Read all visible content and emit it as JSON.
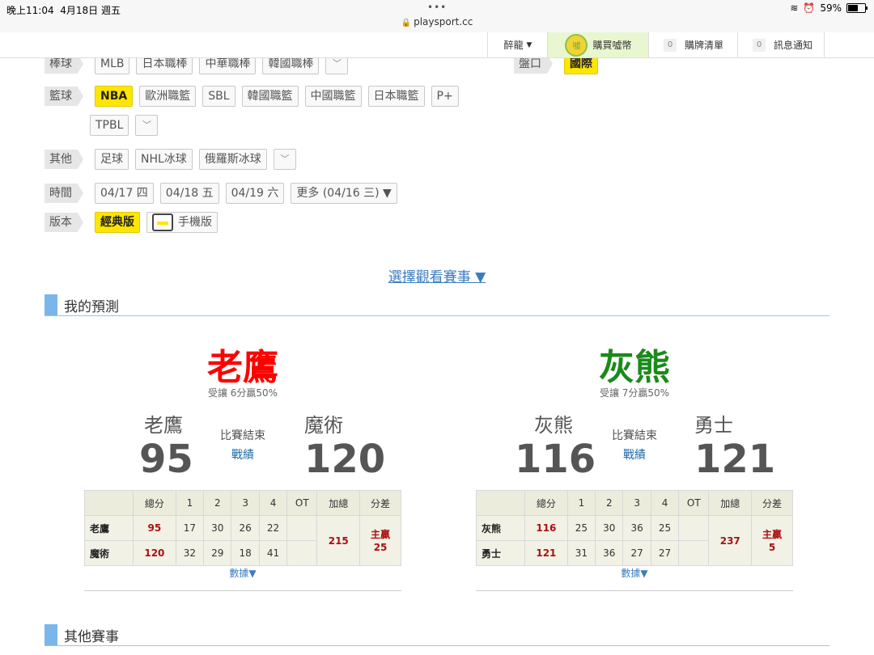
{
  "statusbar": {
    "time": "晚上11:04",
    "date": "4月18日 週五",
    "dots": "•••",
    "url": "playsport.cc",
    "battery": "59%",
    "battery_level": 0.59
  },
  "nav": {
    "user": "醉龍",
    "coin_icon_text": "噓",
    "buy_coins": "購買噓幣",
    "cart_count": "0",
    "cart": "購牌清單",
    "msg_count": "0",
    "messages": "訊息通知"
  },
  "filters": {
    "baseball": {
      "label": "棒球",
      "items": [
        "MLB",
        "日本職棒",
        "中華職棒",
        "韓國職棒"
      ]
    },
    "handicap": {
      "label": "盤口",
      "value": "國際"
    },
    "basketball": {
      "label": "籃球",
      "items": [
        "NBA",
        "歐洲職籃",
        "SBL",
        "韓國職籃",
        "中國職籃",
        "日本職籃",
        "P+"
      ],
      "row2": [
        "TPBL"
      ]
    },
    "other": {
      "label": "其他",
      "items": [
        "足球",
        "NHL冰球",
        "俄羅斯冰球"
      ]
    },
    "time": {
      "label": "時間",
      "items": [
        "04/17 四",
        "04/18 五",
        "04/19 六",
        "更多 (04/16 三) ▼"
      ]
    },
    "version": {
      "label": "版本",
      "classic": "經典版",
      "mobile": "手機版"
    }
  },
  "select_games": "選擇觀看賽事 ▼",
  "my_prediction": "我的預測",
  "other_games": "其他賽事",
  "colors": {
    "pick_red": "#ff0000",
    "pick_green": "#1a8a1a",
    "accent_yellow": "#ffe600",
    "section_blue": "#7bb6ea"
  },
  "games": [
    {
      "pick": "老鷹",
      "odds": "受讓 6分贏50%",
      "away": {
        "name": "老鷹",
        "score": "95"
      },
      "home": {
        "name": "魔術",
        "score": "120"
      },
      "status": "比賽結束",
      "record": "戰績",
      "headers": [
        "總分",
        "1",
        "2",
        "3",
        "4",
        "OT",
        "加總",
        "分差"
      ],
      "rows": [
        {
          "team": "老鷹",
          "total": "95",
          "q": [
            "17",
            "30",
            "26",
            "22"
          ],
          "ot": ""
        },
        {
          "team": "魔術",
          "total": "120",
          "q": [
            "32",
            "29",
            "18",
            "41"
          ],
          "ot": ""
        }
      ],
      "sum": "215",
      "diff1": "主贏",
      "diff2": "25",
      "data": "數據▼"
    },
    {
      "pick": "灰熊",
      "odds": "受讓 7分贏50%",
      "away": {
        "name": "灰熊",
        "score": "116"
      },
      "home": {
        "name": "勇士",
        "score": "121"
      },
      "status": "比賽結束",
      "record": "戰績",
      "headers": [
        "總分",
        "1",
        "2",
        "3",
        "4",
        "OT",
        "加總",
        "分差"
      ],
      "rows": [
        {
          "team": "灰熊",
          "total": "116",
          "q": [
            "25",
            "30",
            "36",
            "25"
          ],
          "ot": ""
        },
        {
          "team": "勇士",
          "total": "121",
          "q": [
            "31",
            "36",
            "27",
            "27"
          ],
          "ot": ""
        }
      ],
      "sum": "237",
      "diff1": "主贏",
      "diff2": "5",
      "data": "數據▼"
    }
  ]
}
